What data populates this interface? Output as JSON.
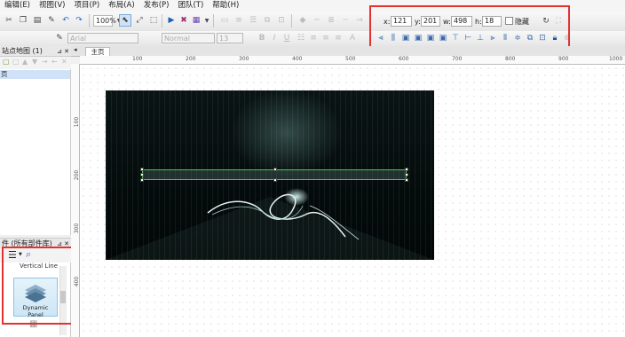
{
  "menu": [
    "编辑(E)",
    "视图(V)",
    "项目(P)",
    "布局(A)",
    "发布(P)",
    "团队(T)",
    "帮助(H)"
  ],
  "toolbar": {
    "zoom": "100%",
    "font_family": "Arial",
    "font_style": "Normal",
    "font_size": "13",
    "bold": "B",
    "italic": "I",
    "underline": "U"
  },
  "position_panel": {
    "x_label": "x:",
    "x_value": "121",
    "y_label": "y:",
    "y_value": "201",
    "w_label": "w:",
    "w_value": "498",
    "h_label": "h:",
    "h_value": "18",
    "hidden_label": "隐藏"
  },
  "sitemap": {
    "title": "站点地图 (1)",
    "selected_item": "页"
  },
  "widgets": {
    "title": "件 (所有部件库)",
    "vertical_line_label": "Vertical Line",
    "dynamic_panel_label": "Dynamic Panel"
  },
  "tab": {
    "label": "主页"
  },
  "ruler": {
    "top_ticks": [
      "100",
      "200",
      "300",
      "400",
      "500",
      "600",
      "700",
      "800",
      "900",
      "1000"
    ],
    "left_ticks": [
      "100",
      "200",
      "300",
      "400"
    ]
  },
  "colors": {
    "highlight_red": "#e53030",
    "selection_green": "#3bd13b"
  }
}
